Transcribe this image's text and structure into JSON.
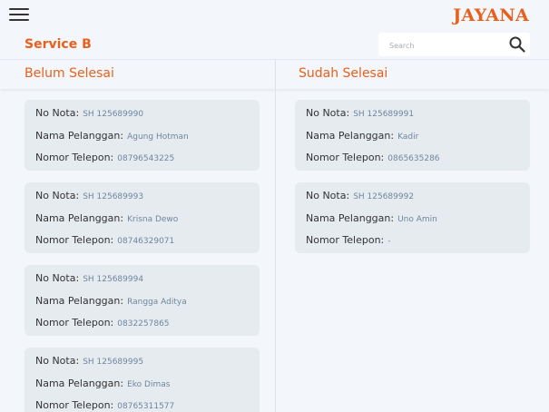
{
  "header": {
    "brand": "JAYANA"
  },
  "subheader": {
    "title": "Service B"
  },
  "search": {
    "placeholder": "Search"
  },
  "columns": {
    "left": {
      "title": "Belum Selesai",
      "cards": [
        {
          "nota": "SH 125689990",
          "nama": "Agung Hotman",
          "telp": "08796543225"
        },
        {
          "nota": "SH 125689993",
          "nama": "Krisna Dewo",
          "telp": "08746329071"
        },
        {
          "nota": "SH 125689994",
          "nama": "Rangga Aditya",
          "telp": "0832257865"
        },
        {
          "nota": "SH 125689995",
          "nama": "Eko Dimas",
          "telp": "08765311577"
        }
      ]
    },
    "right": {
      "title": "Sudah Selesai",
      "cards": [
        {
          "nota": "SH 125689991",
          "nama": "Kadir",
          "telp": "0865635286"
        },
        {
          "nota": "SH 125689992",
          "nama": "Uno Amin",
          "telp": "-"
        }
      ]
    }
  },
  "labels": {
    "nota": "No Nota:",
    "nama": "Nama Pelanggan:",
    "telp": "Nomor Telepon:"
  },
  "icons": {
    "menu": "hamburger-menu-icon",
    "search": "search-icon"
  },
  "colors": {
    "accent": "#e8601c",
    "value": "#6e86a0",
    "card": "#e6ebf0",
    "background": "#f3f6fa"
  }
}
